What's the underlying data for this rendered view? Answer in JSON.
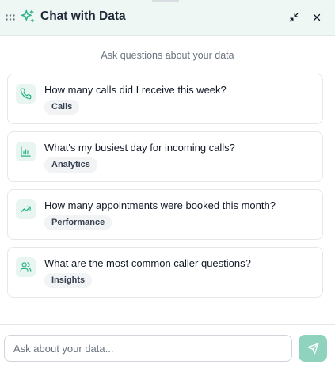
{
  "header": {
    "title": "Chat with Data",
    "icons": {
      "drag": "drag-handle-icon",
      "logo": "sparkle-icon",
      "minimize": "minimize-icon",
      "close": "close-icon"
    }
  },
  "subtitle": "Ask questions about your data",
  "suggestions": [
    {
      "question": "How many calls did I receive this week?",
      "tag": "Calls",
      "icon": "phone-icon"
    },
    {
      "question": "What's my busiest day for incoming calls?",
      "tag": "Analytics",
      "icon": "bar-chart-icon"
    },
    {
      "question": "How many appointments were booked this month?",
      "tag": "Performance",
      "icon": "trending-up-icon"
    },
    {
      "question": "What are the most common caller questions?",
      "tag": "Insights",
      "icon": "users-icon"
    }
  ],
  "input": {
    "placeholder": "Ask about your data...",
    "value": ""
  },
  "colors": {
    "accent": "#2bb38a",
    "header_bg": "#eef7f4",
    "send_bg": "#8fd3bf",
    "icon_bg": "#e8f5f0"
  }
}
